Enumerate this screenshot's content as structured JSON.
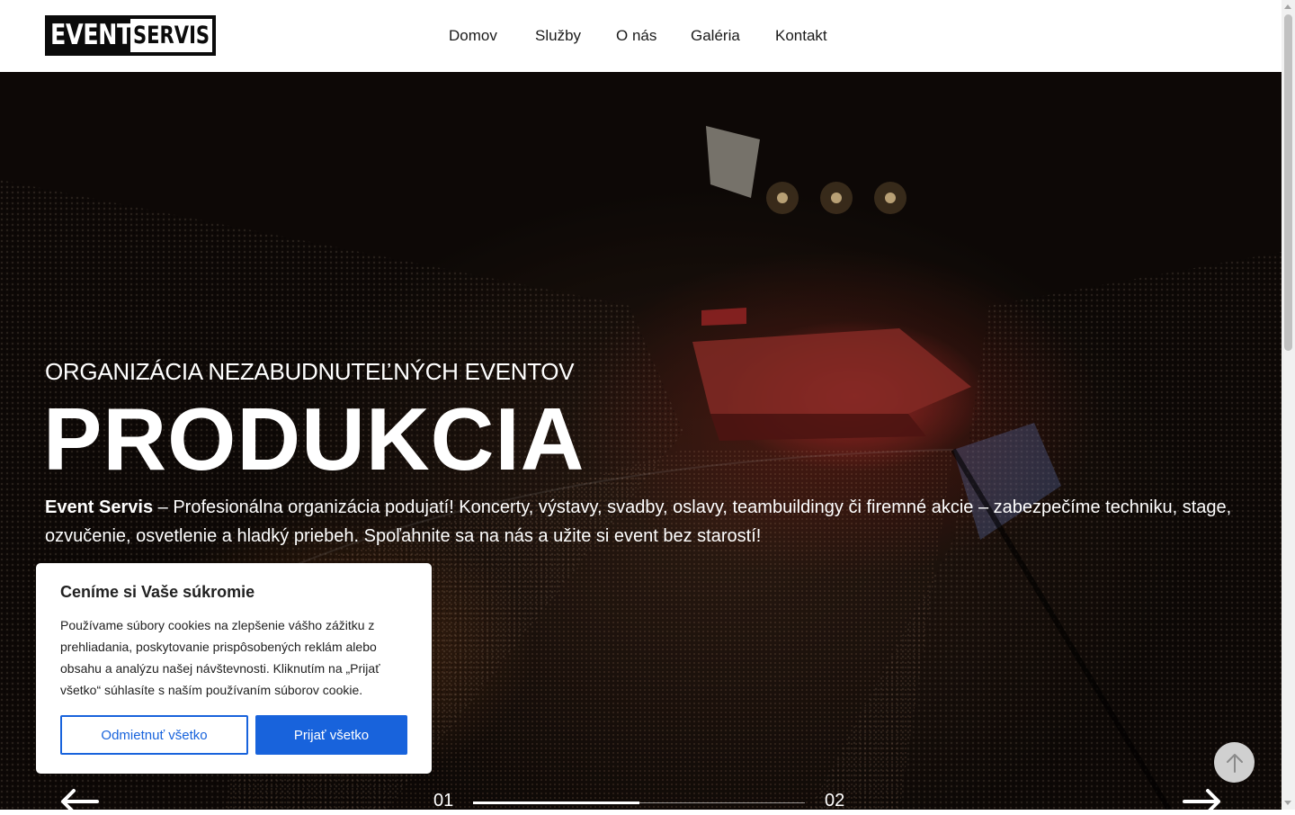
{
  "brand": {
    "logo_part1": "EVENT",
    "logo_part2": "SERVIS"
  },
  "nav": {
    "items": [
      "Domov",
      "Služby",
      "O nás",
      "Galéria",
      "Kontakt"
    ]
  },
  "hero": {
    "subtitle": "ORGANIZÁCIA NEZABUDNUTEĽNÝCH EVENTOV",
    "title": "PRODUKCIA",
    "desc_brand": "Event Servis",
    "desc_text": " – Profesionálna organizácia podujatí! Koncerty, výstavy, svadby, oslavy, teambuildingy či firemné akcie – zabezpečíme techniku, stage, ozvučenie, osvetlenie a hladký priebeh. Spoľahnite sa na nás a užite si event bez starostí!"
  },
  "slider": {
    "current": "01",
    "next": "02",
    "progress_fraction": 0.5
  },
  "cookie": {
    "title": "Ceníme si Vaše súkromie",
    "text": "Používame súbory cookies na zlepšenie vášho zážitku z prehliadania, poskytovanie prispôsobených reklám alebo obsahu a analýzu našej návštevnosti. Kliknutím na „Prijať všetko“ súhlasíte s naším používaním súborov cookie.",
    "reject_label": "Odmietnuť všetko",
    "accept_label": "Prijať všetko"
  },
  "colors": {
    "accent": "#1863dc",
    "text_dark": "#212121",
    "header_bg": "#ffffff"
  },
  "icons": [
    "arrow-left-icon",
    "arrow-right-icon",
    "arrow-up-icon"
  ]
}
